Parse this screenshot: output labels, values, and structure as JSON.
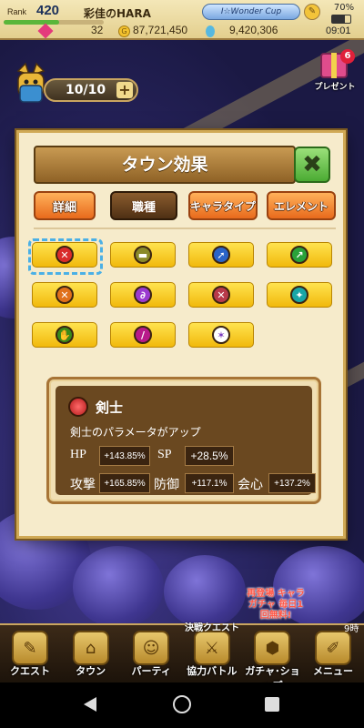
{
  "status_bar": {
    "rank_label": "Rank",
    "rank_value": "420",
    "rank_progress": 0.55,
    "player_name": "彩佳のHARA",
    "banner_text": "I☆Wonder Cup",
    "gem_count": "32",
    "coin_count": "87,721,450",
    "drop_count": "9,420,306",
    "battery": "70%",
    "time": "09:01"
  },
  "stamina": {
    "text": "10/10",
    "plus": "+"
  },
  "present": {
    "label": "プレゼント",
    "badge": "6"
  },
  "dialog": {
    "title": "タウン効果",
    "close": "✖",
    "tabs": [
      {
        "label": "詳細",
        "active": false
      },
      {
        "label": "職種",
        "active": true
      },
      {
        "label": "キャラタイプ",
        "active": false
      },
      {
        "label": "エレメント",
        "active": false
      }
    ],
    "job_icons": [
      {
        "name": "sword-icon",
        "color": "#d92c2c",
        "glyph": "✕"
      },
      {
        "name": "shield-icon",
        "color": "#8a8a2a",
        "glyph": "▬"
      },
      {
        "name": "lance-icon",
        "color": "#2a64c8",
        "glyph": "➚"
      },
      {
        "name": "bow-icon",
        "color": "#2aa23a",
        "glyph": "↗"
      },
      {
        "name": "axe-icon",
        "color": "#e0701c",
        "glyph": "✕"
      },
      {
        "name": "staff-icon",
        "color": "#9a3ad0",
        "glyph": "∂"
      },
      {
        "name": "dagger-icon",
        "color": "#b83a4a",
        "glyph": "✕"
      },
      {
        "name": "shuriken-icon",
        "color": "#1aa6a6",
        "glyph": "✦"
      },
      {
        "name": "fist-icon",
        "color": "#3a8a1a",
        "glyph": "✋"
      },
      {
        "name": "wand-icon",
        "color": "#b81a8a",
        "glyph": "/"
      },
      {
        "name": "mixed-job-icon",
        "color": "#ffffff",
        "glyph": "✶"
      }
    ],
    "info": {
      "name": "剣士",
      "description": "剣士のパラメータがアップ",
      "stats": [
        {
          "label": "HP",
          "value": "+143.85%"
        },
        {
          "label": "SP",
          "value": "+28.5%"
        },
        {
          "label": "攻撃",
          "value": "+165.85%"
        },
        {
          "label": "防御",
          "value": "+117.1%"
        },
        {
          "label": "会心",
          "value": "+137.2%"
        }
      ]
    }
  },
  "bottom_nav": {
    "items": [
      {
        "label": "クエスト",
        "icon": "✎"
      },
      {
        "label": "タウン",
        "icon": "⌂"
      },
      {
        "label": "パーティ",
        "icon": "☺"
      },
      {
        "label": "協力バトル",
        "icon": "⚔"
      },
      {
        "label": "ガチャ･ショップ",
        "icon": "⬢"
      },
      {
        "label": "メニュー",
        "icon": "✐"
      }
    ],
    "battle_top": "決戦クエスト",
    "promo": "再登場 キャラガチャ 毎日1回無料!",
    "side_time": "9時"
  }
}
